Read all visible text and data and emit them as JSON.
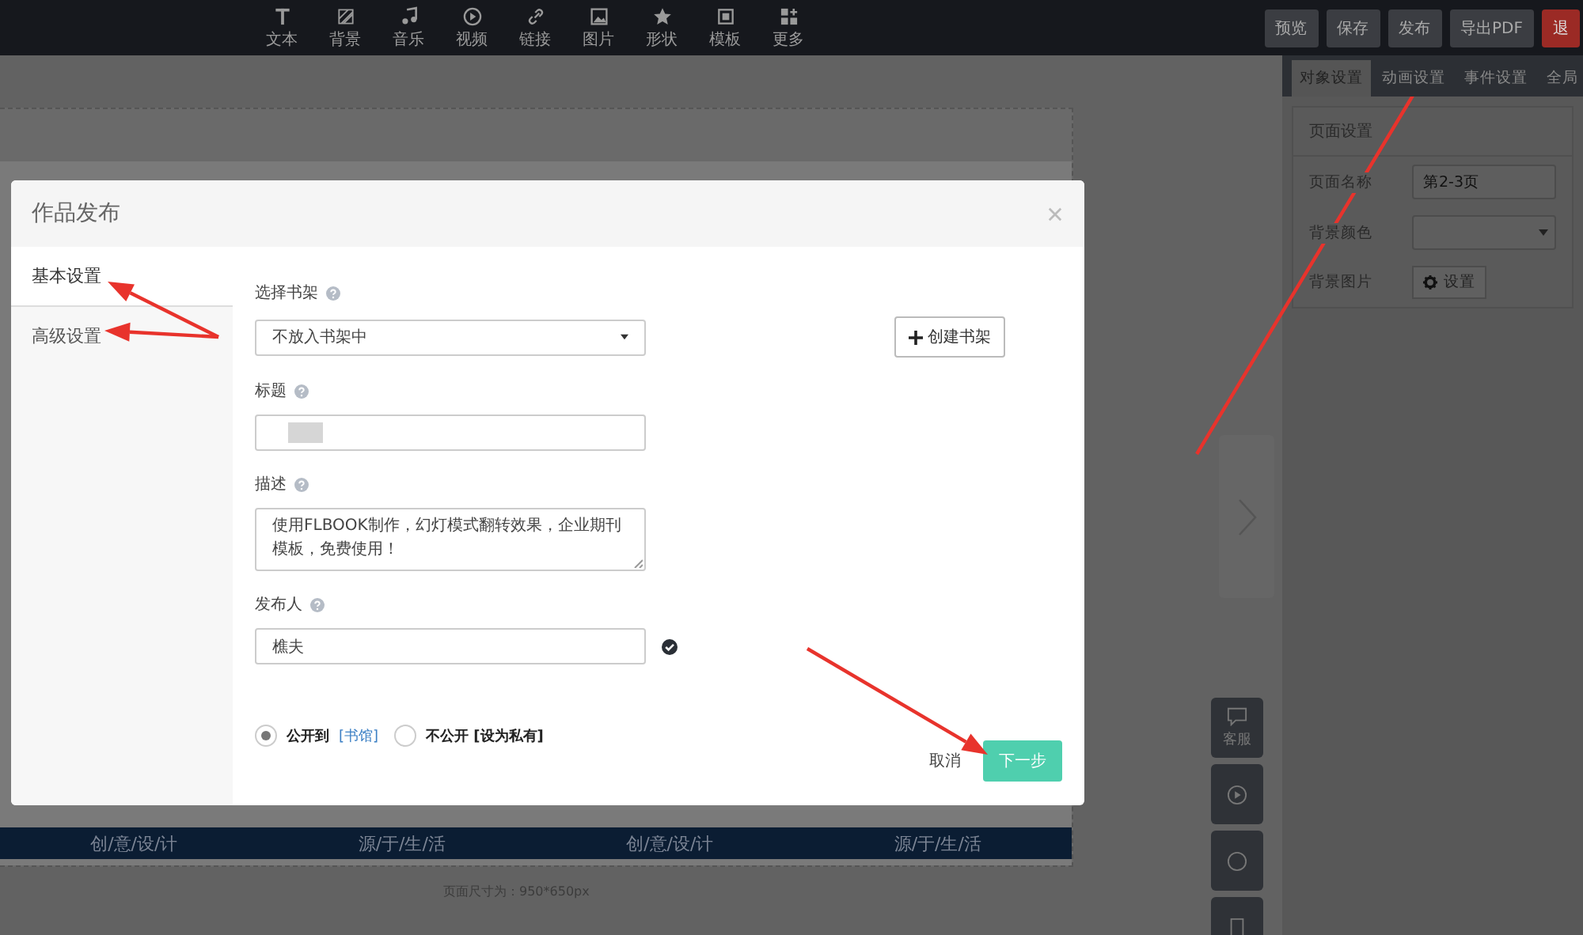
{
  "toolbar": {
    "tools": [
      {
        "label": "文本"
      },
      {
        "label": "背景"
      },
      {
        "label": "音乐"
      },
      {
        "label": "视频"
      },
      {
        "label": "链接"
      },
      {
        "label": "图片"
      },
      {
        "label": "形状"
      },
      {
        "label": "模板"
      },
      {
        "label": "更多"
      }
    ],
    "buttons": [
      {
        "label": "预览",
        "kind": "normal"
      },
      {
        "label": "保存",
        "kind": "normal"
      },
      {
        "label": "发布",
        "kind": "normal"
      },
      {
        "label": "导出PDF",
        "kind": "normal"
      },
      {
        "label": "退",
        "kind": "danger"
      }
    ]
  },
  "side_panel": {
    "tabs": [
      {
        "label": "对象设置",
        "selected": true
      },
      {
        "label": "动画设置",
        "selected": false
      },
      {
        "label": "事件设置",
        "selected": false
      },
      {
        "label": "全局",
        "selected": false
      }
    ],
    "section": "页面设置",
    "rows": [
      {
        "label": "页面名称",
        "kind": "text",
        "value": "第2-3页"
      },
      {
        "label": "背景颜色",
        "kind": "select"
      },
      {
        "label": "背景图片",
        "kind": "button",
        "button": "设置"
      }
    ]
  },
  "canvas": {
    "banner_texts": [
      "创/意/设/计",
      "源/于/生/活",
      "创/意/设/计",
      "源/于/生/活"
    ],
    "page_size": "页面尺寸为：950*650px"
  },
  "side_tools": [
    {
      "label": "客服"
    }
  ],
  "dialog": {
    "title": "作品发布",
    "nav": [
      {
        "label": "基本设置",
        "selected": true
      },
      {
        "label": "高级设置",
        "selected": false
      }
    ],
    "fields": [
      {
        "label": "选择书架",
        "kind": "select",
        "value": "不放入书架中"
      },
      {
        "label": "标题",
        "kind": "redacted"
      },
      {
        "label": "描述",
        "kind": "textarea",
        "value": "使用FLBOOK制作，幻灯模式翻转效果，企业期刊模板，免费使用！"
      },
      {
        "label": "发布人",
        "kind": "text",
        "value": "樵夫",
        "valid": true
      }
    ],
    "create_button": "创建书架",
    "visibility": [
      {
        "text": "公开到",
        "link": "[书馆]",
        "selected": true
      },
      {
        "text": "不公开 [设为私有]",
        "selected": false
      }
    ],
    "cancel": "取消",
    "next": "下一步"
  }
}
